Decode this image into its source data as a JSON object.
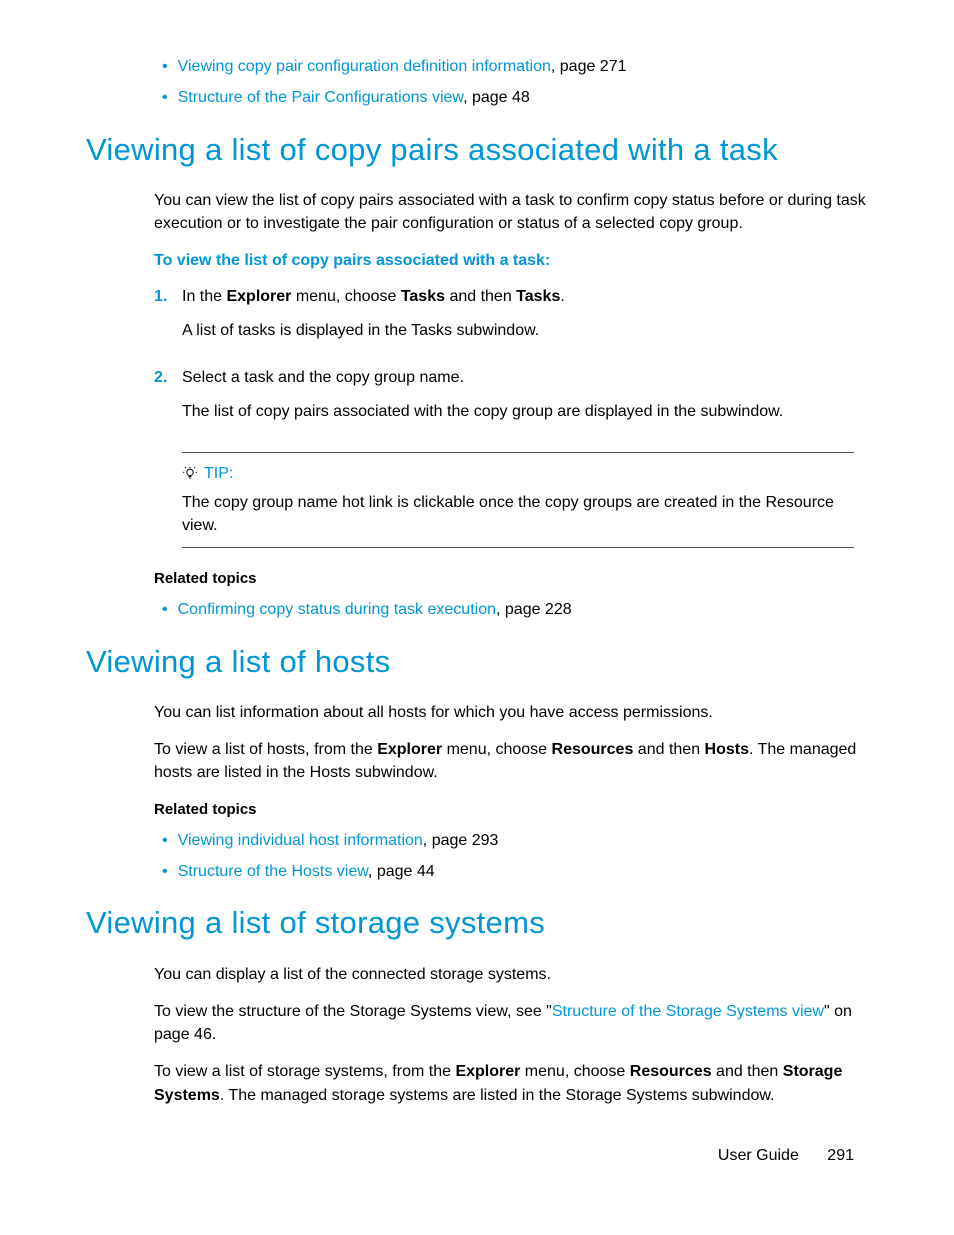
{
  "top_related": {
    "items": [
      {
        "link": "Viewing copy pair configuration definition information",
        "suffix": ", page 271"
      },
      {
        "link": "Structure of the Pair Configurations view",
        "suffix": ", page 48"
      }
    ]
  },
  "section1": {
    "heading": "Viewing a list of copy pairs associated with a task",
    "intro": "You can view the list of copy pairs associated with a task to confirm copy status before or during task execution or to investigate the pair configuration or status of a selected copy group.",
    "proc_title": "To view the list of copy pairs associated with a task:",
    "steps": [
      {
        "num": "1.",
        "line_pre": "In the ",
        "b1": "Explorer",
        "mid1": " menu, choose ",
        "b2": "Tasks",
        "mid2": " and then ",
        "b3": "Tasks",
        "post": ".",
        "result": "A list of tasks is displayed in the Tasks subwindow."
      },
      {
        "num": "2.",
        "line": "Select a task and the copy group name.",
        "result": "The list of copy pairs associated with the copy group are displayed in the subwindow."
      }
    ],
    "tip_label": "TIP:",
    "tip_text": "The copy group name hot link is clickable once the copy groups are created in the Resource view.",
    "related_heading": "Related topics",
    "related_items": [
      {
        "link": "Confirming copy status during task execution",
        "suffix": ", page 228"
      }
    ]
  },
  "section2": {
    "heading": "Viewing a list of hosts",
    "intro": "You can list information about all hosts for which you have access permissions.",
    "para2_pre": "To view a list of hosts, from the ",
    "para2_b1": "Explorer",
    "para2_mid1": " menu, choose ",
    "para2_b2": "Resources",
    "para2_mid2": " and then ",
    "para2_b3": "Hosts",
    "para2_post": ". The managed hosts are listed in the Hosts subwindow.",
    "related_heading": "Related topics",
    "related_items": [
      {
        "link": "Viewing individual host information",
        "suffix": ", page 293"
      },
      {
        "link": "Structure of the Hosts view",
        "suffix": ", page 44"
      }
    ]
  },
  "section3": {
    "heading": "Viewing a list of storage systems",
    "intro": "You can display a list of the connected storage systems.",
    "para2_pre": "To view the structure of the Storage Systems view, see  \"",
    "para2_link": "Structure of the Storage Systems view",
    "para2_post": "\" on page 46.",
    "para3_pre": "To view a list of storage systems, from the ",
    "para3_b1": "Explorer",
    "para3_mid1": " menu, choose ",
    "para3_b2": "Resources",
    "para3_mid2": " and then ",
    "para3_b3": "Storage Systems",
    "para3_post": ". The managed storage systems are listed in the Storage Systems subwindow."
  },
  "footer": {
    "label": "User Guide",
    "page": "291"
  }
}
